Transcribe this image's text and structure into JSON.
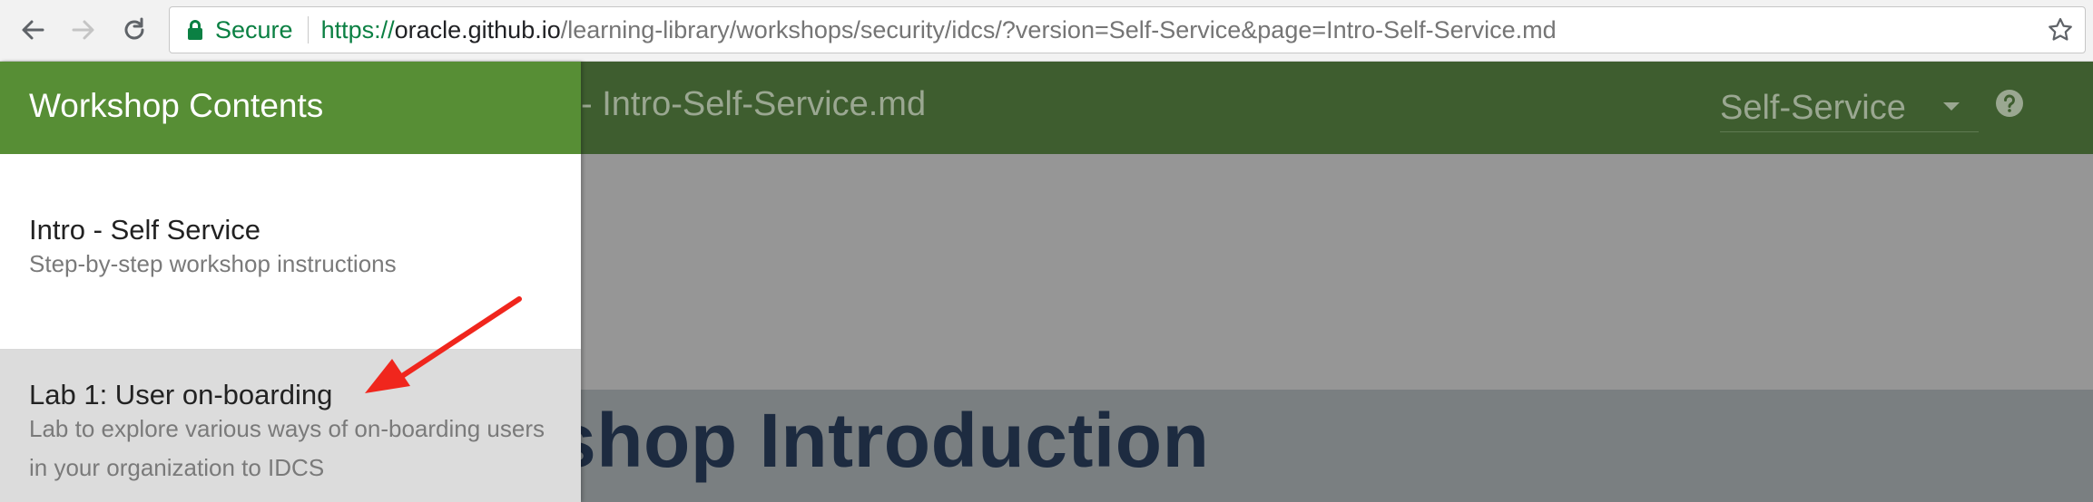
{
  "browser": {
    "secure_label": "Secure",
    "url_scheme": "https://",
    "url_host": "oracle.github.io",
    "url_path": "/learning-library/workshops/security/idcs/?version=Self-Service&page=Intro-Self-Service.md"
  },
  "header": {
    "page_title": "- Intro-Self-Service.md",
    "version_selected": "Self-Service"
  },
  "main": {
    "banner_title": "shop Introduction"
  },
  "drawer": {
    "title": "Workshop Contents",
    "items": [
      {
        "title": "Intro - Self Service",
        "description": "Step-by-step workshop instructions"
      },
      {
        "title": "Lab 1: User on-boarding",
        "description": "Lab to explore various ways of on-boarding users in your organization to IDCS"
      }
    ]
  },
  "colors": {
    "drawer_header": "#578e35",
    "app_header": "#3e5d2f",
    "overlay": "#969696",
    "banner": "#7a7f81",
    "annotation_arrow": "#f0261d",
    "secure_green": "#0b8043"
  },
  "icons": {
    "back": "arrow-left-icon",
    "forward": "arrow-right-icon",
    "reload": "reload-icon",
    "lock": "lock-icon",
    "bookmark": "star-icon",
    "dropdown": "caret-down-icon",
    "help": "help-circle-icon"
  }
}
